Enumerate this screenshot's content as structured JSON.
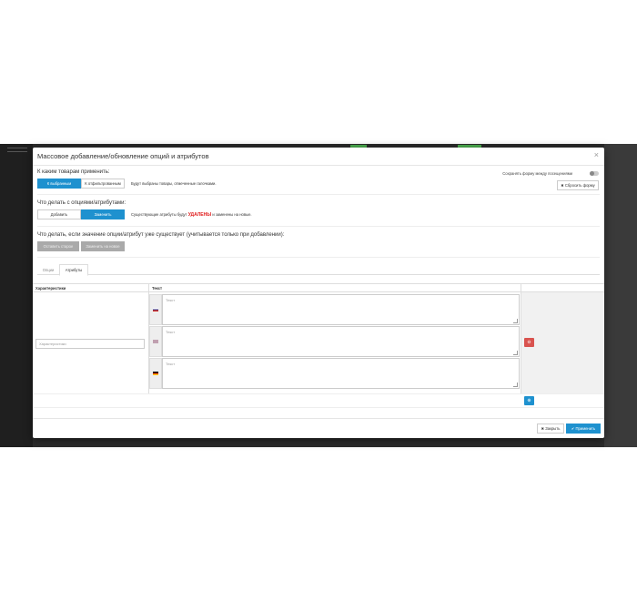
{
  "modal": {
    "title": "Массовое добавление/обновление опций и атрибутов",
    "close_glyph": "×"
  },
  "apply_to": {
    "label": "К каким товарам применить:",
    "options": [
      "К выбранным",
      "К отфильтрованным"
    ],
    "selected": "К выбранным",
    "help": "Будут выбраны товары, отмеченные галочками."
  },
  "remember": {
    "label": "Сохранять форму между посещениями",
    "reset_label": "✖ Сбросить форму"
  },
  "action": {
    "label": "Что делать с опциями/атрибутами:",
    "options": [
      "Добавить",
      "Заменить"
    ],
    "selected": "Заменить",
    "help_before": "Существующие атрибуты будут",
    "help_red": "УДАЛЕНЫ",
    "help_after": "и заменены на новые."
  },
  "if_exists": {
    "label": "Что делать, если значение опции/атрибут уже существует (учитывается только при добавлении):",
    "options": [
      "Оставить старое",
      "Заменить на новое"
    ]
  },
  "tabs": [
    "Опции",
    "Атрибуты"
  ],
  "active_tab": "Атрибуты",
  "table": {
    "headers": [
      "Характеристики",
      "Текст"
    ],
    "characteristic_placeholder": "Характеристики",
    "text_placeholder": "Текст",
    "languages": [
      "ru",
      "en",
      "de"
    ]
  },
  "footer": {
    "close_label": "✖ Закрыть",
    "apply_label": "✔ Применить"
  },
  "colors": {
    "accent": "#1e91cf",
    "danger": "#d9534f",
    "highlight_red": "#e01b1b"
  }
}
